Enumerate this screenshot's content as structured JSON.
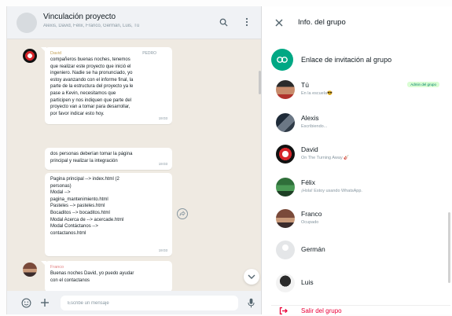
{
  "chat": {
    "title": "Vinculación proyecto",
    "members": "Alexis, David, Félix, Franco, Germán, Luis, Tú",
    "messages": [
      {
        "sender": "David",
        "tag": "PEDRO",
        "lines": [
          "compañeros buenas noches, tenemos",
          "que realizar este proyecto que inició el",
          "ingeniero. Nadie se ha pronunciado, yo",
          "estoy avanzando con el informe final, la",
          "parte de la estructura del proyecto ya le",
          "pase a Kevin, necesitamos que",
          "participen y nos indiquen que parte del",
          "proyecto van a tomar para desarrollar,",
          "por favor indicar esto hoy."
        ],
        "time": "19:03"
      },
      {
        "lines": [
          "dos personas deberían tomar la página",
          "principal y realizar la integración"
        ],
        "time": "19:03"
      },
      {
        "lines": [
          "Pagina principal   --> index.html (2",
          "personas)",
          "Modal                 -->",
          "pagina_mantenimiento.html",
          "Pasteles              --> pasteles.html",
          "Bocaditos            --> bocaditos.html",
          "Modal Acerca de    --> acercade.html",
          "Modal Contáctanos  -->",
          "contactanos.html"
        ],
        "time": "19:03"
      },
      {
        "sender": "Franco",
        "lines": [
          "Buenas noches David, yo puedo ayudar",
          "con el contactanos"
        ]
      }
    ],
    "composer_placeholder": "Escribe un mensaje"
  },
  "info": {
    "title": "Info. del grupo",
    "invite_icon": "link-icon",
    "invite_label": "Enlace de invitación al grupo",
    "members": [
      {
        "name": "Tú",
        "status": "En la escuela😎",
        "badge": "Admin del grupo"
      },
      {
        "name": "Alexis",
        "status": "Escribiendo..."
      },
      {
        "name": "David",
        "status": "On The Turning Away 🎸"
      },
      {
        "name": "Félix",
        "status": "¡Hola! Estoy usando WhatsApp."
      },
      {
        "name": "Franco",
        "status": "Ocupado"
      },
      {
        "name": "Germán",
        "status": ""
      },
      {
        "name": "Luis",
        "status": ""
      }
    ],
    "exit_label": "Salir del grupo"
  },
  "colors": {
    "accent": "#00a884",
    "chat_bg": "#efeae2",
    "danger": "#ea0038"
  }
}
